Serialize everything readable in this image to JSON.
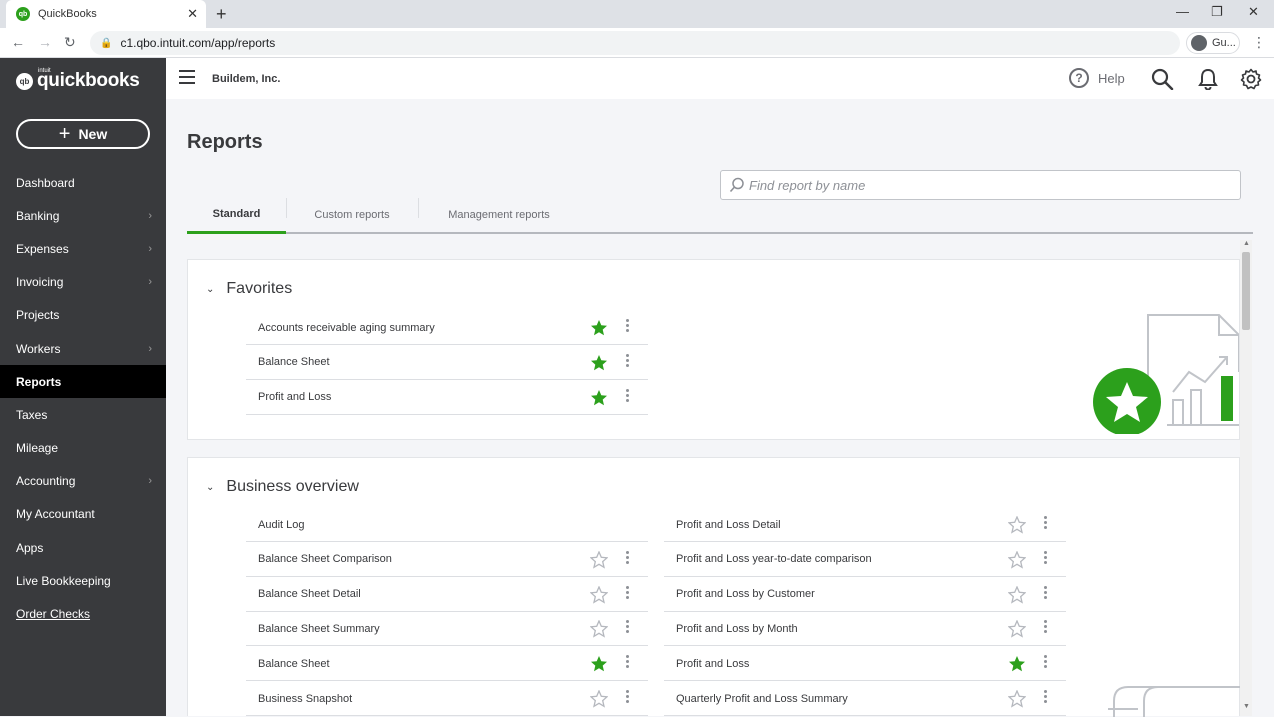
{
  "browser": {
    "tab_title": "QuickBooks",
    "url": "c1.qbo.intuit.com/app/reports",
    "profile_label": "Gu..."
  },
  "sidebar": {
    "logo_small": "intuit",
    "logo_word": "quickbooks",
    "new_label": "New",
    "items": [
      {
        "label": "Dashboard",
        "chevron": false
      },
      {
        "label": "Banking",
        "chevron": true
      },
      {
        "label": "Expenses",
        "chevron": true
      },
      {
        "label": "Invoicing",
        "chevron": true
      },
      {
        "label": "Projects",
        "chevron": false
      },
      {
        "label": "Workers",
        "chevron": true
      },
      {
        "label": "Reports",
        "chevron": false,
        "active": true
      },
      {
        "label": "Taxes",
        "chevron": false
      },
      {
        "label": "Mileage",
        "chevron": false
      },
      {
        "label": "Accounting",
        "chevron": true
      },
      {
        "label": "My Accountant",
        "chevron": false
      },
      {
        "label": "Apps",
        "chevron": false
      },
      {
        "label": "Live Bookkeeping",
        "chevron": false
      },
      {
        "label": "Order Checks",
        "chevron": false,
        "link": true
      }
    ]
  },
  "header": {
    "company": "Buildem, Inc.",
    "help_label": "Help"
  },
  "main": {
    "title": "Reports",
    "search_placeholder": "Find report by name",
    "tabs": [
      "Standard",
      "Custom reports",
      "Management reports"
    ],
    "favorites": {
      "title": "Favorites",
      "rows": [
        {
          "label": "Accounts receivable aging summary",
          "favorited": true
        },
        {
          "label": "Balance Sheet",
          "favorited": true
        },
        {
          "label": "Profit and Loss",
          "favorited": true
        }
      ]
    },
    "business_overview": {
      "title": "Business overview",
      "left": [
        {
          "label": "Audit Log",
          "favorited": null
        },
        {
          "label": "Balance Sheet Comparison",
          "favorited": false
        },
        {
          "label": "Balance Sheet Detail",
          "favorited": false
        },
        {
          "label": "Balance Sheet Summary",
          "favorited": false
        },
        {
          "label": "Balance Sheet",
          "favorited": true
        },
        {
          "label": "Business Snapshot",
          "favorited": false
        }
      ],
      "right": [
        {
          "label": "Profit and Loss Detail",
          "favorited": false
        },
        {
          "label": "Profit and Loss year-to-date comparison",
          "favorited": false
        },
        {
          "label": "Profit and Loss by Customer",
          "favorited": false
        },
        {
          "label": "Profit and Loss by Month",
          "favorited": false
        },
        {
          "label": "Profit and Loss",
          "favorited": true
        },
        {
          "label": "Quarterly Profit and Loss Summary",
          "favorited": false
        }
      ]
    }
  },
  "colors": {
    "accent": "#2ca01c",
    "sidebar": "#393a3d"
  }
}
